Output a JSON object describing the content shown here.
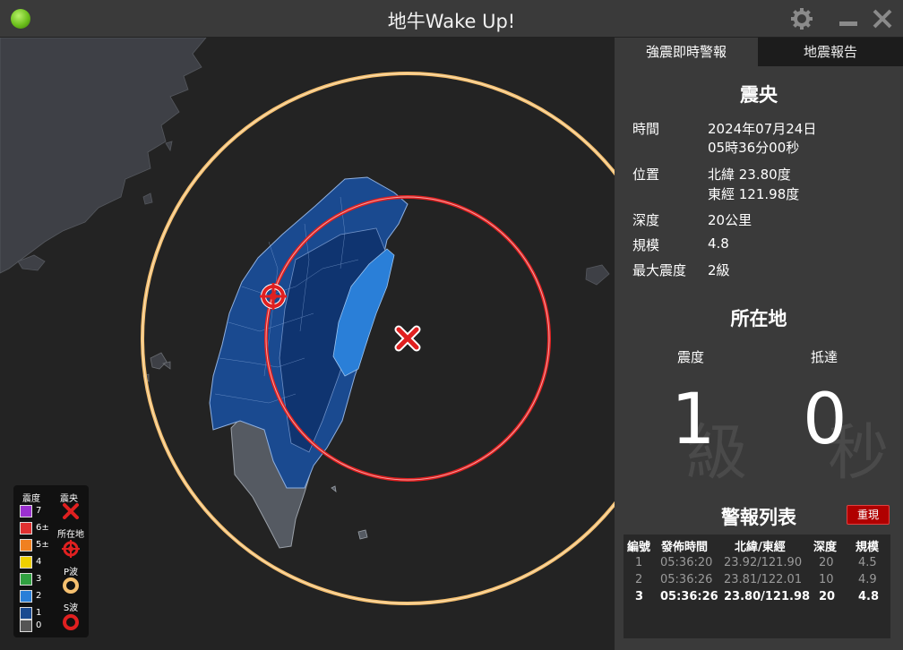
{
  "window": {
    "title": "地牛Wake Up!"
  },
  "tabs": [
    {
      "label": "強震即時警報"
    },
    {
      "label": "地震報告"
    }
  ],
  "epicenter": {
    "heading": "震央",
    "time_label": "時間",
    "date": "2024年07月24日",
    "time": "05時36分00秒",
    "position_label": "位置",
    "latitude": "北緯 23.80度",
    "longitude": "東經 121.98度",
    "depth_label": "深度",
    "depth": "20公里",
    "magnitude_label": "規模",
    "magnitude": "4.8",
    "max_intensity_label": "最大震度",
    "max_intensity": "2級"
  },
  "location": {
    "heading": "所在地",
    "intensity_label": "震度",
    "arrival_label": "抵達",
    "intensity_value": "1",
    "intensity_unit": "級",
    "arrival_value": "0",
    "arrival_unit": "秒"
  },
  "alerts": {
    "heading": "警報列表",
    "reset_label": "重現",
    "columns": [
      "編號",
      "發佈時間",
      "北緯/東經",
      "深度",
      "規模"
    ],
    "rows": [
      {
        "no": "1",
        "time": "05:36:20",
        "coords": "23.92/121.90",
        "depth": "20",
        "mag": "4.5"
      },
      {
        "no": "2",
        "time": "05:36:26",
        "coords": "23.81/122.01",
        "depth": "10",
        "mag": "4.9"
      },
      {
        "no": "3",
        "time": "05:36:26",
        "coords": "23.80/121.98",
        "depth": "20",
        "mag": "4.8"
      }
    ]
  },
  "legend": {
    "intensity_heading": "震度",
    "epicenter_heading": "震央",
    "location_label": "所在地",
    "p_wave_label": "P波",
    "s_wave_label": "S波",
    "levels": [
      {
        "label": "7",
        "color": "#9b30d0"
      },
      {
        "label": "6±",
        "color": "#e03030"
      },
      {
        "label": "5±",
        "color": "#f08020"
      },
      {
        "label": "4",
        "color": "#f0d000"
      },
      {
        "label": "3",
        "color": "#30a040"
      },
      {
        "label": "2",
        "color": "#2a7fd8"
      },
      {
        "label": "1",
        "color": "#1a4a90"
      },
      {
        "label": "0",
        "color": "#555555"
      }
    ]
  },
  "colors": {
    "p_wave": "#f5c070",
    "s_wave": "#e02020",
    "intensity_1": "#1a4a90",
    "intensity_2": "#2a7fd8",
    "intensity_0": "#555555"
  }
}
